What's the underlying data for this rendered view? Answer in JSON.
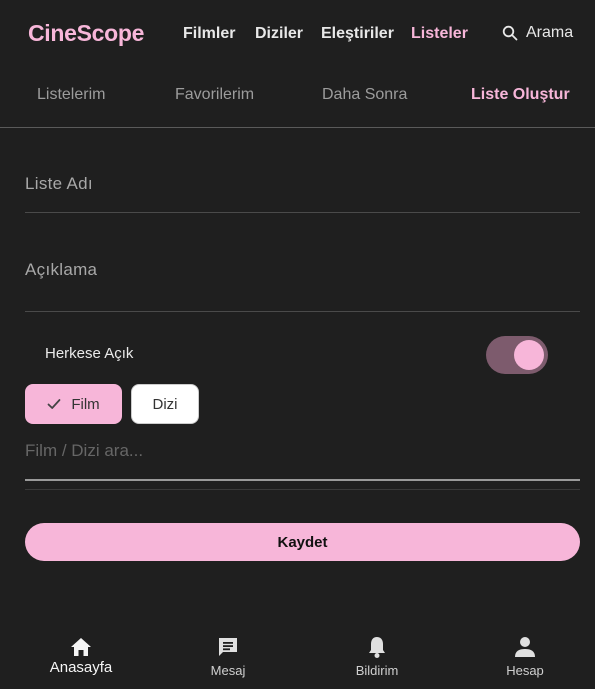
{
  "header": {
    "brand": "CineScope",
    "nav": [
      "Filmler",
      "Diziler",
      "Eleştiriler",
      "Listeler"
    ],
    "active_nav": "Listeler",
    "search_label": "Arama"
  },
  "tabs": [
    "Listelerim",
    "Favorilerim",
    "Daha Sonra",
    "Liste Oluştur"
  ],
  "active_tab": "Liste Oluştur",
  "form": {
    "name_placeholder": "Liste Adı",
    "desc_placeholder": "Açıklama",
    "public_label": "Herkese Açık",
    "public_enabled": true,
    "chips": [
      {
        "label": "Film",
        "selected": true
      },
      {
        "label": "Dizi",
        "selected": false
      }
    ],
    "search_placeholder": "Film / Dizi ara...",
    "save_label": "Kaydet"
  },
  "bottom_nav": [
    {
      "label": "Anasayfa",
      "icon": "home-icon",
      "active": true
    },
    {
      "label": "Mesaj",
      "icon": "message-icon",
      "active": false
    },
    {
      "label": "Bildirim",
      "icon": "bell-icon",
      "active": false
    },
    {
      "label": "Hesap",
      "icon": "person-icon",
      "active": false
    }
  ],
  "colors": {
    "accent": "#f7b6d9",
    "background": "#1f1f1f",
    "switch_track": "#7d5b6d"
  }
}
